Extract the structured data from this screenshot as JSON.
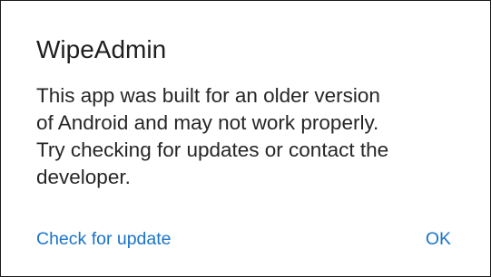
{
  "dialog": {
    "title": "WipeAdmin",
    "message_lines": [
      "This app was built for an older version",
      "of Android and may not work properly.",
      "Try checking for updates or contact the",
      "developer."
    ],
    "buttons": {
      "check_update_label": "Check for update",
      "ok_label": "OK"
    }
  },
  "colors": {
    "accent": "#1a73c8",
    "text_primary": "#1f1f1f",
    "background": "#ffffff"
  }
}
